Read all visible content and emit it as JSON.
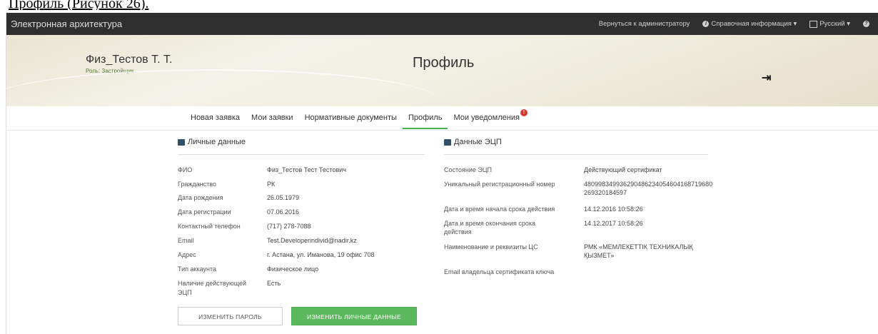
{
  "caption": "Профиль (Рисунок 26).",
  "navbar": {
    "brand": "Электронная архитектура",
    "back_to_admin": "Вернуться к администратору",
    "help": "Справочная информация ▾",
    "language": "Русский ▾",
    "help_icon": "question-circle-icon"
  },
  "header": {
    "user_name": "Физ_Тестов Т. Т.",
    "role": "Роль: Застройщик",
    "title": "Профиль",
    "logout_icon": "sign-out-icon"
  },
  "tabs": [
    {
      "label": "Новая заявка",
      "active": false
    },
    {
      "label": "Мои заявки",
      "active": false
    },
    {
      "label": "Нормативные документы",
      "active": false
    },
    {
      "label": "Профиль",
      "active": true
    },
    {
      "label": "Мои уведомления",
      "active": false,
      "badge": "!"
    }
  ],
  "personal": {
    "heading": "Личные данные",
    "rows": [
      {
        "label": "ФИО",
        "value": "Физ_Тестов Тест Тестович"
      },
      {
        "label": "Гражданство",
        "value": "РК"
      },
      {
        "label": "Дата рождения",
        "value": "26.05.1979"
      },
      {
        "label": "Дата регистрации",
        "value": "07.06.2016"
      },
      {
        "label": "Контактный телефон",
        "value": "(717) 278-7088"
      },
      {
        "label": "Email",
        "value": "Test.Developerindivid@nadir.kz"
      },
      {
        "label": "Адрес",
        "value": "г. Астана, ул. Иманова, 19 офис 708"
      },
      {
        "label": "Тип аккаунта",
        "value": "Физическое лицо"
      },
      {
        "label": "Наличие действующей",
        "label2": "ЭЦП",
        "value": "Есть"
      }
    ],
    "change_password": "ИЗМЕНИТЬ ПАРОЛЬ",
    "change_data": "ИЗМЕНИТЬ ЛИЧНЫЕ ДАННЫЕ"
  },
  "ecp": {
    "heading": "Данные ЭЦП",
    "rows": [
      {
        "label": "Состояние ЭЦП",
        "value": "Действующий сертификат"
      },
      {
        "label": "Уникальный регистрационный номер",
        "value": "480998349936290486234054604168719680269320184597"
      },
      {
        "label": "Дата и время начала срока действия",
        "value": "14.12.2016 10:58:26"
      },
      {
        "label": "Дата и время окончания срока действия",
        "value": "14.12.2017 10:58:26"
      },
      {
        "label": "Наименование и реквизиты ЦС",
        "value": "РМК «МЕМЛЕКЕТТІК ТЕХНИКАЛЫҚ ҚЫЗМЕТ»"
      },
      {
        "label": "Email владельца сертификата ключа",
        "value": ""
      }
    ]
  }
}
